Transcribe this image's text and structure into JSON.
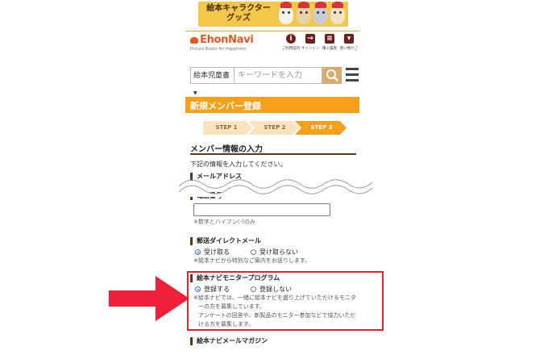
{
  "banner": {
    "text": "絵本キャラクター\nグッズ"
  },
  "header": {
    "logo_text": "EhonNavi",
    "logo_sub": "Picture Books for Happiness",
    "icons": [
      {
        "label": "ご利用案内",
        "icon": "info-icon"
      },
      {
        "label": "サインイン",
        "icon": "sign-in-icon"
      },
      {
        "label": "購入履歴",
        "icon": "purchase-history-icon"
      },
      {
        "label": "買い物かご",
        "icon": "cart-icon"
      }
    ]
  },
  "search": {
    "category": "絵本児童書",
    "placeholder": "キーワードを入力"
  },
  "page": {
    "title": "新規メンバー登録"
  },
  "steps": [
    "STEP 1",
    "STEP 2",
    "STEP 3"
  ],
  "active_step": 3,
  "form": {
    "section_title": "メンバー情報の入力",
    "instruction": "下記の情報を入力してください。",
    "email_label": "メールアドレス",
    "tel_label": "電話番号",
    "tel_note": "※数字とハイフン(-)のみ",
    "dm": {
      "label": "郵送ダイレクトメール",
      "options": [
        "受け取る",
        "受け取らない"
      ],
      "selected": 0,
      "note": "※絵本ナビから特別なご案内をお送りします。"
    },
    "monitor": {
      "label": "絵本ナビモニタープログラム",
      "options": [
        "登録する",
        "登録しない"
      ],
      "selected": 0,
      "note_lines": [
        "※絵本ナビでは、一緒に絵本ナビを盛り上げていただけるモニタ",
        "ーの方を募集しています。",
        "アンケートの回答や、新製品のモニター参加などで協力いただ",
        "ける方を募集します。"
      ]
    },
    "magazine_label": "絵本ナビメールマガジン"
  },
  "colors": {
    "brand_orange": "#f5a01a",
    "logo_orange": "#e8581e",
    "highlight_red": "#e2242c",
    "arrow_red": "#f0203a",
    "radio_blue": "#3a6fd8"
  }
}
